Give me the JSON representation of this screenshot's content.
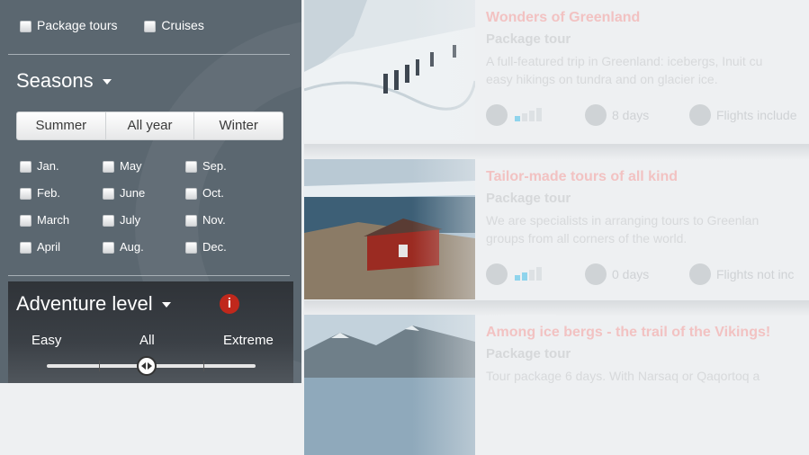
{
  "filters": {
    "types": [
      "Package tours",
      "Cruises"
    ],
    "seasons_title": "Seasons",
    "seasons": [
      "Summer",
      "All year",
      "Winter"
    ],
    "months": [
      "Jan.",
      "Feb.",
      "March",
      "April",
      "May",
      "June",
      "July",
      "Aug.",
      "Sep.",
      "Oct.",
      "Nov.",
      "Dec."
    ],
    "adventure_title": "Adventure level",
    "info_icon_label": "i",
    "adventure_levels": {
      "easy": "Easy",
      "all": "All",
      "extreme": "Extreme"
    },
    "adventure_slider_value": 0.5
  },
  "tours": [
    {
      "title": "Wonders of Greenland",
      "type": "Package tour",
      "description": "A full-featured trip in Greenland: icebergs, Inuit cu",
      "description2": "easy hikings on tundra and on glacier ice.",
      "days": "8 days",
      "flights": "Flights include",
      "difficulty_level": 1
    },
    {
      "title": "Tailor-made tours of all kind",
      "type": "Package tour",
      "description": "We are specialists in arranging tours to Greenlan",
      "description2": "groups from all corners of the world.",
      "days": "0 days",
      "flights": "Flights not inc",
      "difficulty_level": 2
    },
    {
      "title": "Among ice bergs - the trail of the Vikings!",
      "type": "Package tour",
      "description": "Tour package 6 days. With Narsaq or Qaqortoq a"
    }
  ],
  "colors": {
    "sidebar": "#5b6770",
    "accent_red": "#c0281c",
    "title_faded": "#f2c2c2",
    "bar_active": "#8fd4ec"
  }
}
